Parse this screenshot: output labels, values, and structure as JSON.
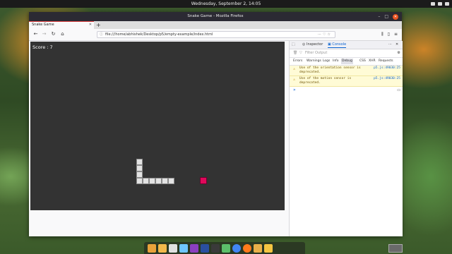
{
  "system": {
    "clock": "Wednesday, September 2, 14:05"
  },
  "window": {
    "title": "Snake Game - Mozilla Firefox"
  },
  "tabs": [
    {
      "label": "Snake Game"
    }
  ],
  "navbar": {
    "url": "file:///home/abhishek/Desktop/p5/empty-example/index.html"
  },
  "game": {
    "score_label": "Score : 7",
    "background": "#333333",
    "snake_color": "#e3e3e3",
    "food_color": "#e0085a"
  },
  "devtools": {
    "tabs": [
      "Inspector",
      "Console"
    ],
    "active_tab": "Console",
    "filter_placeholder": "Filter Output",
    "categories": [
      "Errors",
      "Warnings",
      "Logs",
      "Info",
      "Debug",
      "CSS",
      "XHR",
      "Requests"
    ],
    "messages": [
      {
        "text": "Use of the orientation sensor is deprecated.",
        "source": "p5.js:49030:25"
      },
      {
        "text": "Use of the motion sensor is deprecated.",
        "source": "p5.js:49030:25"
      }
    ],
    "prompt": "»"
  },
  "dock": {
    "icons": [
      "files-icon",
      "folder-icon",
      "rhythmbox-icon",
      "color-icon",
      "store-icon",
      "settings-icon",
      "terminal-icon",
      "sublime-icon",
      "chrome-icon",
      "firefox-icon",
      "nautilus-icon",
      "trash-icon"
    ],
    "colors": [
      "#e9a23b",
      "#f2b84b",
      "#e0e0e0",
      "#6ec6ff",
      "#8b3fbf",
      "#2a4fa0",
      "#3a3a3a",
      "#5cbf6a",
      "#4285f4",
      "#ff7a1a",
      "#e8b04a",
      "#f4c542"
    ]
  }
}
